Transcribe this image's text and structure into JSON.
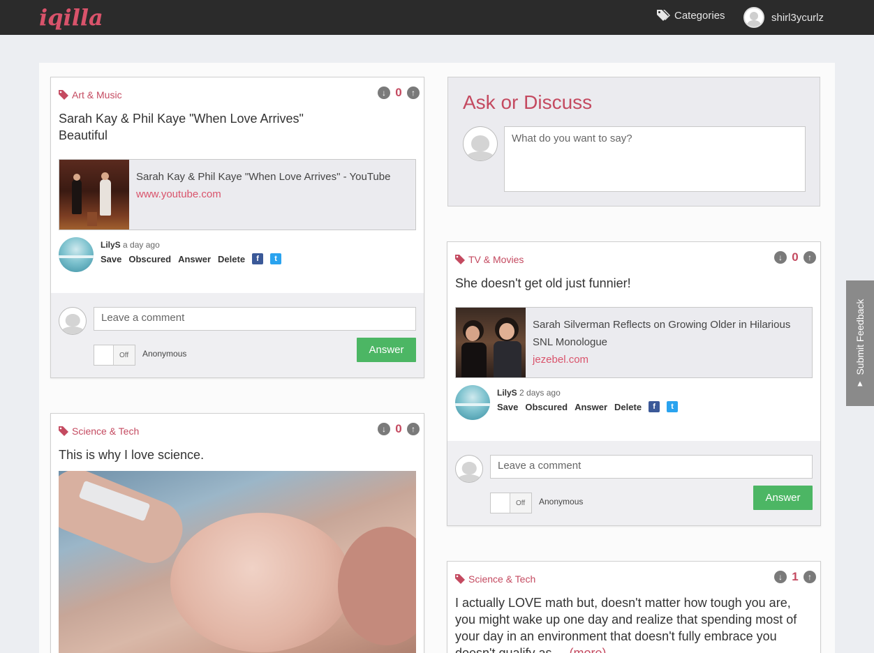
{
  "app": {
    "logo": "iqilla"
  },
  "nav": {
    "categories_label": "Categories",
    "username": "shirl3ycurlz"
  },
  "ask": {
    "title": "Ask or Discuss",
    "placeholder": "What do you want to say?"
  },
  "feedback": {
    "label": "Submit Feedback"
  },
  "posts": [
    {
      "category": "Art & Music",
      "votes": "0",
      "title_line1": "Sarah Kay & Phil Kaye \"When Love Arrives\"",
      "title_line2": "Beautiful",
      "link_title": "Sarah Kay & Phil Kaye \"When Love Arrives\" - YouTube",
      "link_url": "www.youtube.com",
      "author": "LilyS",
      "time": "a day ago",
      "actions": [
        "Save",
        "Obscured",
        "Answer",
        "Delete"
      ],
      "comment_placeholder": "Leave a comment",
      "toggle_label": "Off",
      "anonymous_label": "Anonymous",
      "answer_label": "Answer"
    },
    {
      "category": "Science & Tech",
      "votes": "0",
      "title_line1": "This is why I love science."
    },
    {
      "category": "TV & Movies",
      "votes": "0",
      "title_line1": "She doesn't get old just funnier!",
      "link_title": "Sarah Silverman Reflects on Growing Older in Hilarious SNL Monologue",
      "link_url": "jezebel.com",
      "author": "LilyS",
      "time": "2 days ago",
      "actions": [
        "Save",
        "Obscured",
        "Answer",
        "Delete"
      ],
      "comment_placeholder": "Leave a comment",
      "toggle_label": "Off",
      "anonymous_label": "Anonymous",
      "answer_label": "Answer"
    },
    {
      "category": "Science & Tech",
      "votes": "1",
      "title_line1": "I actually LOVE math but, doesn't matter how tough you are, you might wake up one day and realize that spending most of your day in an environment that doesn't fully embrace you doesn't qualify as",
      "more_label": "... (more)"
    }
  ],
  "colors": {
    "accent": "#c44a60",
    "answer_green": "#4cb664",
    "topbar": "#2b2b2b"
  },
  "icons": [
    "tag-icon",
    "arrow-down-icon",
    "arrow-up-icon",
    "facebook-icon",
    "twitter-icon",
    "avatar-placeholder-icon"
  ]
}
